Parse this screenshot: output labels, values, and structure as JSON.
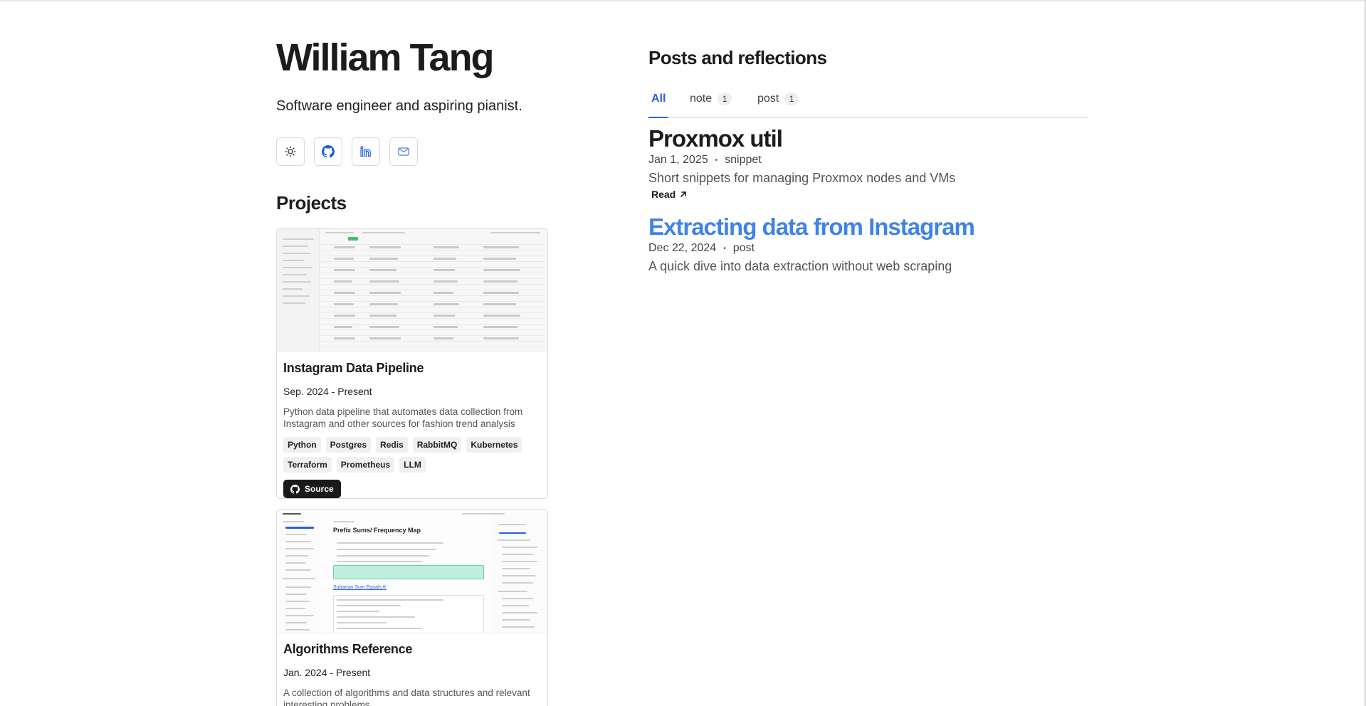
{
  "profile": {
    "name": "William Tang",
    "tagline": "Software engineer and aspiring pianist.",
    "icons": [
      "theme-toggle-icon",
      "github-icon",
      "linkedin-icon",
      "mail-icon"
    ]
  },
  "projects": {
    "heading": "Projects",
    "items": [
      {
        "title": "Instagram Data Pipeline",
        "date": "Sep. 2024 - Present",
        "description": "Python data pipeline that automates data collection from Instagram and other sources for fashion trend analysis",
        "tags": [
          "Python",
          "Postgres",
          "Redis",
          "RabbitMQ",
          "Kubernetes",
          "Terraform",
          "Prometheus",
          "LLM"
        ],
        "source_label": "Source"
      },
      {
        "title": "Algorithms Reference",
        "date": "Jan. 2024 - Present",
        "description": "A collection of algorithms and data structures and relevant interesting problems.",
        "thumbnail": {
          "title": "Prefix Sums/ Frequency Map",
          "link": "Subarray Sum Equals K"
        }
      }
    ]
  },
  "posts": {
    "heading": "Posts and reflections",
    "tabs": [
      {
        "label": "All"
      },
      {
        "label": "note",
        "count": "1"
      },
      {
        "label": "post",
        "count": "1"
      }
    ],
    "items": [
      {
        "title": "Proxmox util",
        "date": "Jan 1, 2025",
        "separator": "•",
        "kind": "snippet",
        "description": "Short snippets for managing Proxmox nodes and VMs",
        "read_label": "Read"
      },
      {
        "title": "Extracting data from Instagram",
        "date": "Dec 22, 2024",
        "separator": "•",
        "kind": "post",
        "description": "A quick dive into data extraction without web scraping"
      }
    ]
  },
  "colors": {
    "accent": "#2a62d8",
    "link_title": "#3f83e6",
    "text": "#1c1c1c"
  }
}
